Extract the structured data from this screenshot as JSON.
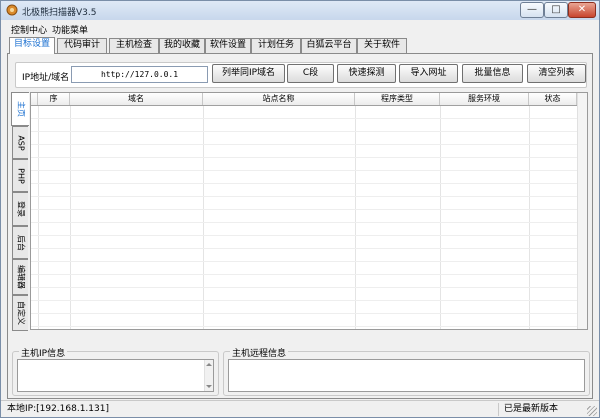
{
  "window": {
    "title": "北极熊扫描器V3.5",
    "controls": [
      "—",
      "□",
      "✕"
    ]
  },
  "menu": {
    "items": [
      "控制中心",
      "功能菜单"
    ]
  },
  "tabs": [
    "目标设置",
    "代码审计",
    "主机检查",
    "我的收藏",
    "软件设置",
    "计划任务",
    "白狐云平台",
    "关于软件"
  ],
  "active_tab": "目标设置",
  "toolbar": {
    "ip_label": "IP地址/域名",
    "ip_value": "http://127.0.0.1",
    "buttons": [
      "列举同IP域名",
      "C段",
      "快速探测",
      "导入网址",
      "批量信息",
      "清空列表"
    ]
  },
  "side_tabs": [
    "主页",
    "ASP",
    "PHP",
    "登录",
    "后台",
    "编辑器",
    "自定义"
  ],
  "active_side_tab": "主页",
  "table": {
    "columns": [
      "序",
      "域名",
      "站点名称",
      "程序类型",
      "服务环境",
      "状态"
    ]
  },
  "host_ip_panel": {
    "title": "主机IP信息"
  },
  "remote_panel": {
    "title": "主机远程信息"
  },
  "status": {
    "local_ip": "本地IP:[192.168.1.131]",
    "version": "已是最新版本"
  }
}
